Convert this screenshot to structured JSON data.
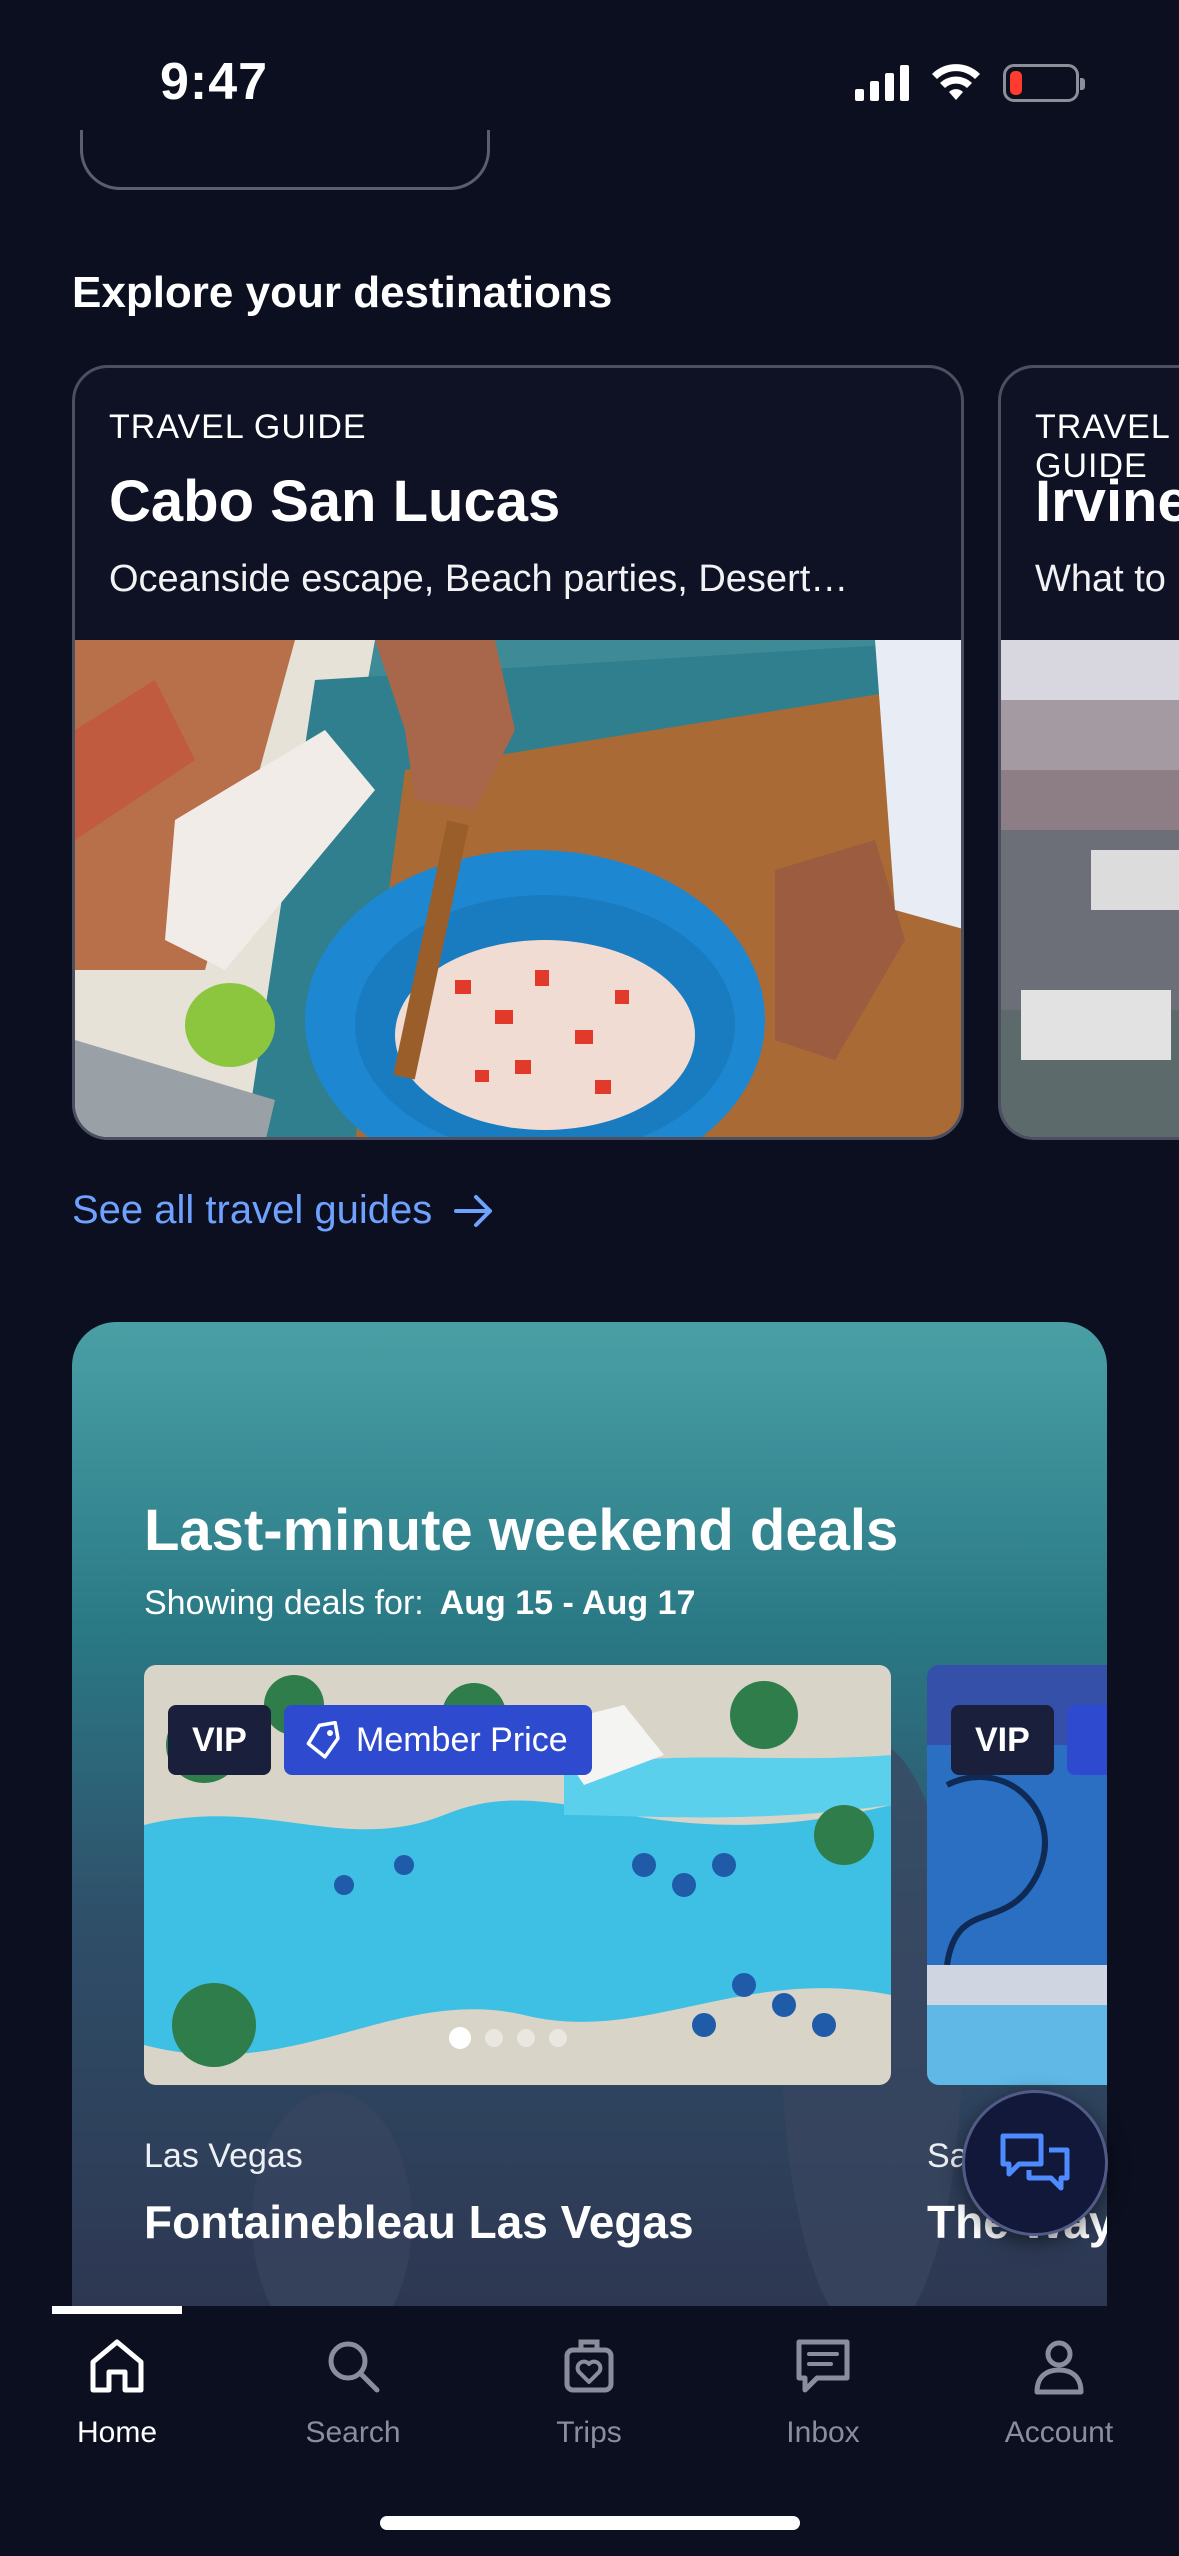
{
  "status": {
    "time": "9:47"
  },
  "explore": {
    "title": "Explore your destinations",
    "guides": [
      {
        "kicker": "TRAVEL GUIDE",
        "title": "Cabo San Lucas",
        "subtitle": "Oceanside escape, Beach parties, Desert…"
      },
      {
        "kicker": "TRAVEL GUIDE",
        "title": "Irvine",
        "subtitle": "What to"
      }
    ],
    "see_all": "See all travel guides"
  },
  "deals": {
    "title": "Last-minute weekend deals",
    "showing_label": "Showing deals for:",
    "dates": "Aug 15 - Aug 17",
    "hotels": [
      {
        "vip": "VIP",
        "member": "Member Price",
        "location": "Las Vegas",
        "name": "Fontainebleau Las Vegas"
      },
      {
        "vip": "VIP",
        "location": "Sa",
        "name": "The Way"
      }
    ],
    "carousel_dots": 4,
    "active_dot": 1
  },
  "tabs": [
    {
      "label": "Home",
      "icon": "home-icon",
      "active": true
    },
    {
      "label": "Search",
      "icon": "search-icon",
      "active": false
    },
    {
      "label": "Trips",
      "icon": "suitcase-heart-icon",
      "active": false
    },
    {
      "label": "Inbox",
      "icon": "message-icon",
      "active": false
    },
    {
      "label": "Account",
      "icon": "person-icon",
      "active": false
    }
  ],
  "colors": {
    "background": "#0b0f1f",
    "link": "#6fa1ff",
    "member_badge": "#2e4bcf",
    "vip_badge": "#1a1f3c"
  }
}
